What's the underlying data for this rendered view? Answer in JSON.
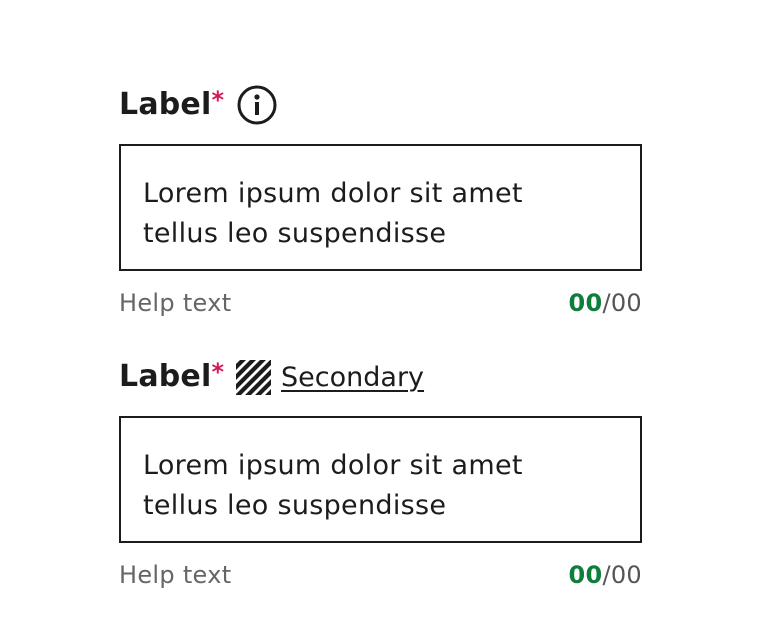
{
  "fields": [
    {
      "label": "Label",
      "required_marker": "*",
      "icon": "info-circle-icon",
      "value": "Lorem ipsum dolor sit amet\ntellus leo suspendisse",
      "help_text": "Help text",
      "counter_current": "00",
      "counter_separator": "/",
      "counter_max": "00"
    },
    {
      "label": "Label",
      "required_marker": "*",
      "icon": "hatch-pattern-icon",
      "secondary_link": "Secondary",
      "value": "Lorem ipsum dolor sit amet\ntellus leo suspendisse",
      "help_text": "Help text",
      "counter_current": "00",
      "counter_separator": "/",
      "counter_max": "00"
    }
  ],
  "colors": {
    "text": "#1c1c1c",
    "required": "#d01c52",
    "counter_current": "#0e7f3b",
    "help_text": "#666666",
    "border": "#1c1c1c"
  }
}
